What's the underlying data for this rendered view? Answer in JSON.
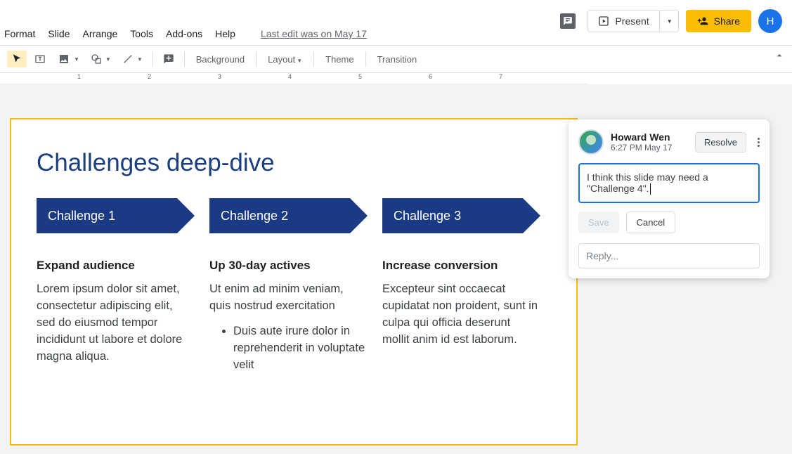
{
  "header": {
    "present_label": "Present",
    "share_label": "Share",
    "avatar_initial": "H"
  },
  "menu": {
    "items": [
      "Format",
      "Slide",
      "Arrange",
      "Tools",
      "Add-ons",
      "Help"
    ],
    "last_edit": "Last edit was on May 17"
  },
  "toolbar": {
    "background": "Background",
    "layout": "Layout",
    "theme": "Theme",
    "transition": "Transition"
  },
  "ruler": {
    "marks": [
      "1",
      "2",
      "3",
      "4",
      "5",
      "6",
      "7"
    ]
  },
  "slide": {
    "title": "Challenges deep-dive",
    "challenges": [
      {
        "label": "Challenge 1",
        "subtitle": "Expand audience",
        "body": "Lorem ipsum dolor sit amet, consectetur adipiscing elit, sed do eiusmod tempor incididunt ut labore et dolore magna aliqua.",
        "bullets": []
      },
      {
        "label": "Challenge 2",
        "subtitle": "Up 30-day actives",
        "body": "Ut enim ad minim veniam, quis nostrud exercitation",
        "bullets": [
          "Duis aute irure dolor in reprehenderit in voluptate velit"
        ]
      },
      {
        "label": "Challenge 3",
        "subtitle": "Increase conversion",
        "body": "Excepteur sint occaecat cupidatat non proident, sunt in culpa qui officia deserunt mollit anim id est laborum.",
        "bullets": []
      }
    ]
  },
  "comment": {
    "author": "Howard Wen",
    "timestamp": "6:27 PM May 17",
    "resolve_label": "Resolve",
    "text": "I think this slide may need a \"Challenge 4\".",
    "save_label": "Save",
    "cancel_label": "Cancel",
    "reply_placeholder": "Reply..."
  }
}
